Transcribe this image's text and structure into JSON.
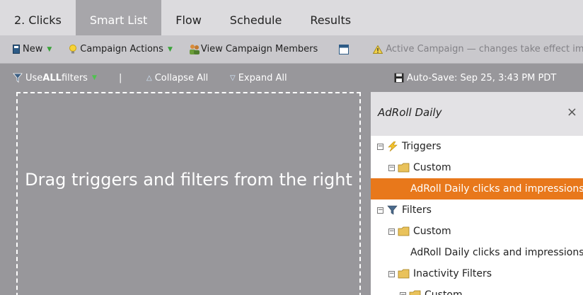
{
  "tabs": [
    {
      "label": "2. Clicks"
    },
    {
      "label": "Smart List"
    },
    {
      "label": "Flow"
    },
    {
      "label": "Schedule"
    },
    {
      "label": "Results"
    }
  ],
  "toolbar": {
    "new_label": "New",
    "campaign_actions_label": "Campaign Actions",
    "view_members_label": "View Campaign Members",
    "status_text": "Active Campaign — changes take effect immed"
  },
  "filterbar": {
    "use_label": "Use ",
    "use_all": "ALL",
    "use_suffix": " filters",
    "separator": "|",
    "collapse_label": "Collapse All",
    "expand_label": "Expand All",
    "autosave_text": "Auto-Save: Sep 25, 3:43 PM PDT"
  },
  "dropzone": {
    "text": "Drag triggers and filters from the right"
  },
  "panel": {
    "title": "AdRoll Daily",
    "close": "×",
    "tree": {
      "triggers": "Triggers",
      "triggers_custom": "Custom",
      "trigger_item": "AdRoll Daily clicks and impressions",
      "filters": "Filters",
      "filters_custom": "Custom",
      "filter_item": "AdRoll Daily clicks and impressions",
      "inactivity": "Inactivity Filters",
      "inactivity_custom": "Custom"
    }
  },
  "colors": {
    "accent_orange": "#e8781b",
    "active_tab": "#a7a6aa",
    "canvas_bg": "#98979b"
  }
}
